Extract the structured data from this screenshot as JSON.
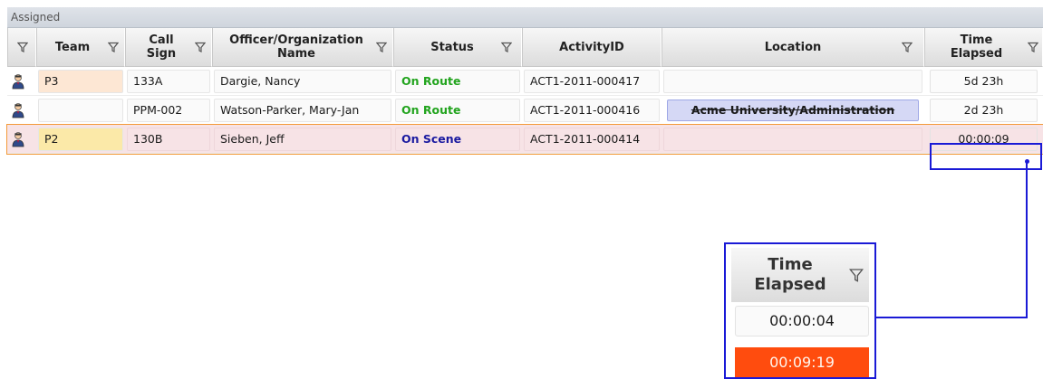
{
  "panel": {
    "title": "Assigned"
  },
  "columns": {
    "team": "Team",
    "call_sign_1": "Call",
    "call_sign_2": "Sign",
    "officer_1": "Officer/Organization",
    "officer_2": "Name",
    "status": "Status",
    "activity": "ActivityID",
    "location": "Location",
    "elapsed_1": "Time",
    "elapsed_2": "Elapsed"
  },
  "rows": [
    {
      "team": "P3",
      "call_sign": "133A",
      "officer": "Dargie, Nancy",
      "status": "On Route",
      "activity_id": "ACT1-2011-000417",
      "location": "",
      "elapsed": "5d 23h"
    },
    {
      "team": "",
      "call_sign": "PPM-002",
      "officer": "Watson-Parker, Mary-Jan",
      "status": "On Route",
      "activity_id": "ACT1-2011-000416",
      "location": "Acme University/Administration",
      "elapsed": "2d 23h"
    },
    {
      "team": "P2",
      "call_sign": "130B",
      "officer": "Sieben, Jeff",
      "status": "On Scene",
      "activity_id": "ACT1-2011-000414",
      "location": "",
      "elapsed": "00:00:09"
    }
  ],
  "zoom": {
    "header_1": "Time",
    "header_2": "Elapsed",
    "value_normal": "00:00:04",
    "value_alert": "00:09:19"
  },
  "colors": {
    "on_route": "#22a41e",
    "on_scene": "#1a1aa0",
    "callout": "#1a1ad6",
    "alert": "#ff4c0e",
    "selected_row": "#f7e3e6",
    "team_p3": "#fde7d4",
    "team_p2": "#fbe9a8"
  },
  "icons": {
    "filter": "filter-funnel-icon",
    "unit": "officer-person-icon"
  }
}
